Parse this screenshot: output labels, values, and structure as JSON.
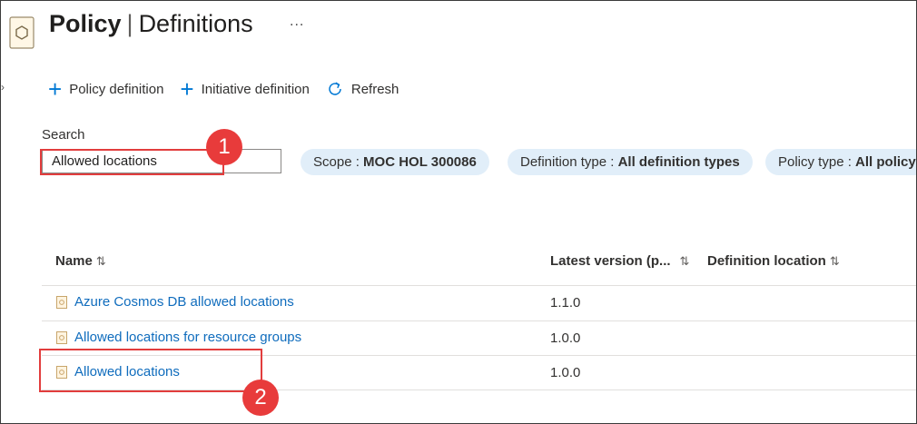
{
  "header": {
    "title_main": "Policy",
    "title_separator": "|",
    "title_sub": "Definitions",
    "more_label": "..."
  },
  "toolbar": {
    "policy_definition_label": "Policy definition",
    "initiative_definition_label": "Initiative definition",
    "refresh_label": "Refresh"
  },
  "search": {
    "label": "Search",
    "value": "Allowed locations"
  },
  "filters": [
    {
      "key": "Scope : ",
      "value": "MOC HOL 300086"
    },
    {
      "key": "Definition type : ",
      "value": "All definition types"
    },
    {
      "key": "Policy type : ",
      "value": "All policy"
    }
  ],
  "table": {
    "columns": [
      "Name",
      "Latest version (p...",
      "Definition location"
    ],
    "sort_icon": "⇅",
    "rows": [
      {
        "name": "Azure Cosmos DB allowed locations",
        "version": "1.1.0"
      },
      {
        "name": "Allowed locations for resource groups",
        "version": "1.0.0"
      },
      {
        "name": "Allowed locations",
        "version": "1.0.0"
      }
    ]
  },
  "annotations": {
    "badge_1": "1",
    "badge_2": "2",
    "highlight_color": "#e23d3d"
  },
  "colors": {
    "accent": "#0078d4",
    "link": "#0f6cbd",
    "pill_bg": "#e1eef9"
  },
  "icons": [
    "policy-icon",
    "plus-icon",
    "refresh-icon",
    "chevron-right-icon",
    "sort-icon",
    "definition-icon"
  ]
}
